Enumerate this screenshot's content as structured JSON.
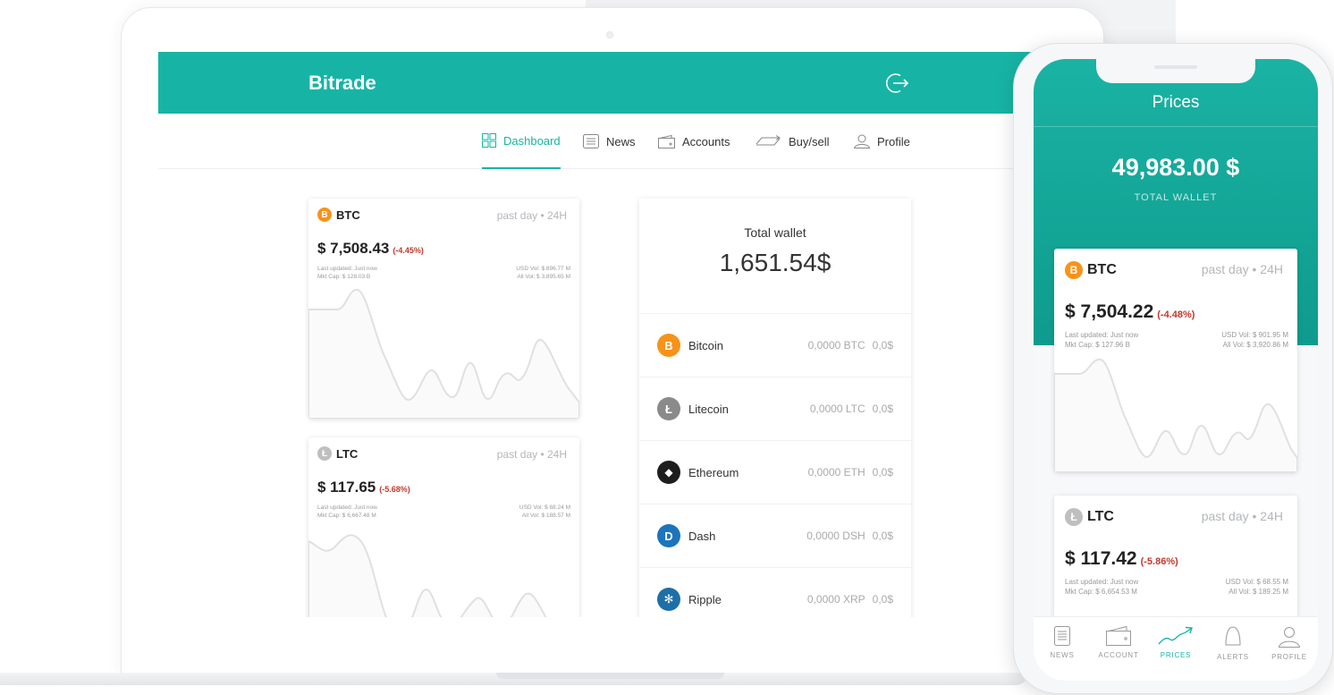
{
  "app": {
    "brand": "Bitrade"
  },
  "nav": {
    "items": [
      {
        "label": "Dashboard",
        "icon": "grid-icon",
        "active": true
      },
      {
        "label": "News",
        "icon": "newspaper-icon"
      },
      {
        "label": "Accounts",
        "icon": "wallet-icon"
      },
      {
        "label": "Buy/sell",
        "icon": "exchange-icon"
      },
      {
        "label": "Profile",
        "icon": "user-icon"
      }
    ]
  },
  "cards": [
    {
      "symbol": "BTC",
      "period": "past day • 24H",
      "price": "$ 7,508.43",
      "change": "(-4.45%)",
      "updated": "Last updated: Just now",
      "mktcap": "Mkt Cap: $ 128.03 B",
      "usdvol": "USD Vol: $ 896.77 M",
      "allvol": "All Vol: $ 3,895.65 M",
      "color": "#f7931a"
    },
    {
      "symbol": "LTC",
      "period": "past day • 24H",
      "price": "$ 117.65",
      "change": "(-5.68%)",
      "updated": "Last updated: Just now",
      "mktcap": "Mkt Cap: $ 6,667.48 M",
      "usdvol": "USD Vol: $ 68.24 M",
      "allvol": "All Vol: $ 188.57 M",
      "color": "#bfbfbf"
    }
  ],
  "wallet": {
    "title": "Total wallet",
    "total": "1,651.54$",
    "rows": [
      {
        "name": "Bitcoin",
        "amount": "0,0000 BTC",
        "value": "0,0$",
        "color": "#f7931a",
        "glyph": "B"
      },
      {
        "name": "Litecoin",
        "amount": "0,0000 LTC",
        "value": "0,0$",
        "color": "#8a8a8a",
        "glyph": "Ł"
      },
      {
        "name": "Ethereum",
        "amount": "0,0000 ETH",
        "value": "0,0$",
        "color": "#1e1e1e",
        "glyph": "◆"
      },
      {
        "name": "Dash",
        "amount": "0,0000 DSH",
        "value": "0,0$",
        "color": "#1c75bc",
        "glyph": "D"
      },
      {
        "name": "Ripple",
        "amount": "0,0000 XRP",
        "value": "0,0$",
        "color": "#1e6fa8",
        "glyph": "✻"
      }
    ]
  },
  "phone": {
    "title": "Prices",
    "total": "49,983.00 $",
    "total_label": "TOTAL WALLET",
    "cards": [
      {
        "symbol": "BTC",
        "period": "past day • 24H",
        "price": "$ 7,504.22",
        "change": "(-4.48%)",
        "updated": "Last updated: Just now",
        "mktcap": "Mkt Cap: $ 127.96 B",
        "usdvol": "USD Vol: $ 901.95 M",
        "allvol": "All Vol: $ 3,920.86 M",
        "color": "#f7931a"
      },
      {
        "symbol": "LTC",
        "period": "past day • 24H",
        "price": "$ 117.42",
        "change": "(-5.86%)",
        "updated": "Last updated: Just now",
        "mktcap": "Mkt Cap: $ 6,654.53 M",
        "usdvol": "USD Vol: $ 68.55 M",
        "allvol": "All Vol: $ 189.25 M",
        "color": "#bfbfbf"
      }
    ],
    "tabs": [
      {
        "label": "NEWS",
        "icon": "newspaper-icon"
      },
      {
        "label": "ACCOUNT",
        "icon": "wallet-icon"
      },
      {
        "label": "PRICES",
        "icon": "trend-icon",
        "active": true
      },
      {
        "label": "ALERTS",
        "icon": "bell-icon"
      },
      {
        "label": "PROFILE",
        "icon": "user-icon"
      }
    ]
  },
  "colors": {
    "accent": "#17b4a5",
    "negative": "#c0392b"
  }
}
